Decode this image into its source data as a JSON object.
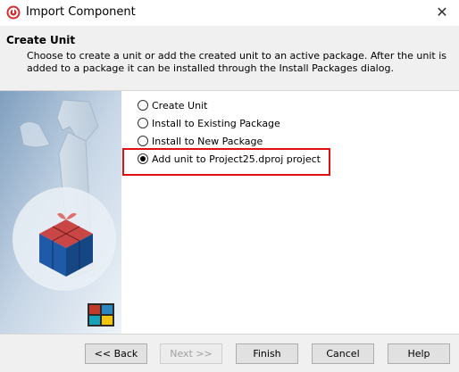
{
  "window": {
    "title": "Import Component",
    "close_glyph": "✕",
    "icon": "delphi-app-icon"
  },
  "header": {
    "title": "Create Unit",
    "description": "Choose to create a unit or add the created unit to an active package. After the unit is added to a package it can be installed through the Install Packages dialog."
  },
  "options": [
    {
      "label": "Create Unit",
      "checked": false
    },
    {
      "label": "Install to Existing Package",
      "checked": false
    },
    {
      "label": "Install to New Package",
      "checked": false
    },
    {
      "label": "Add unit to Project25.dproj project",
      "checked": true
    }
  ],
  "buttons": {
    "back": "<< Back",
    "next": "Next >>",
    "finish": "Finish",
    "cancel": "Cancel",
    "help": "Help"
  },
  "colors": {
    "highlight": "#e01010",
    "panel_bg": "#f0f0f0"
  }
}
